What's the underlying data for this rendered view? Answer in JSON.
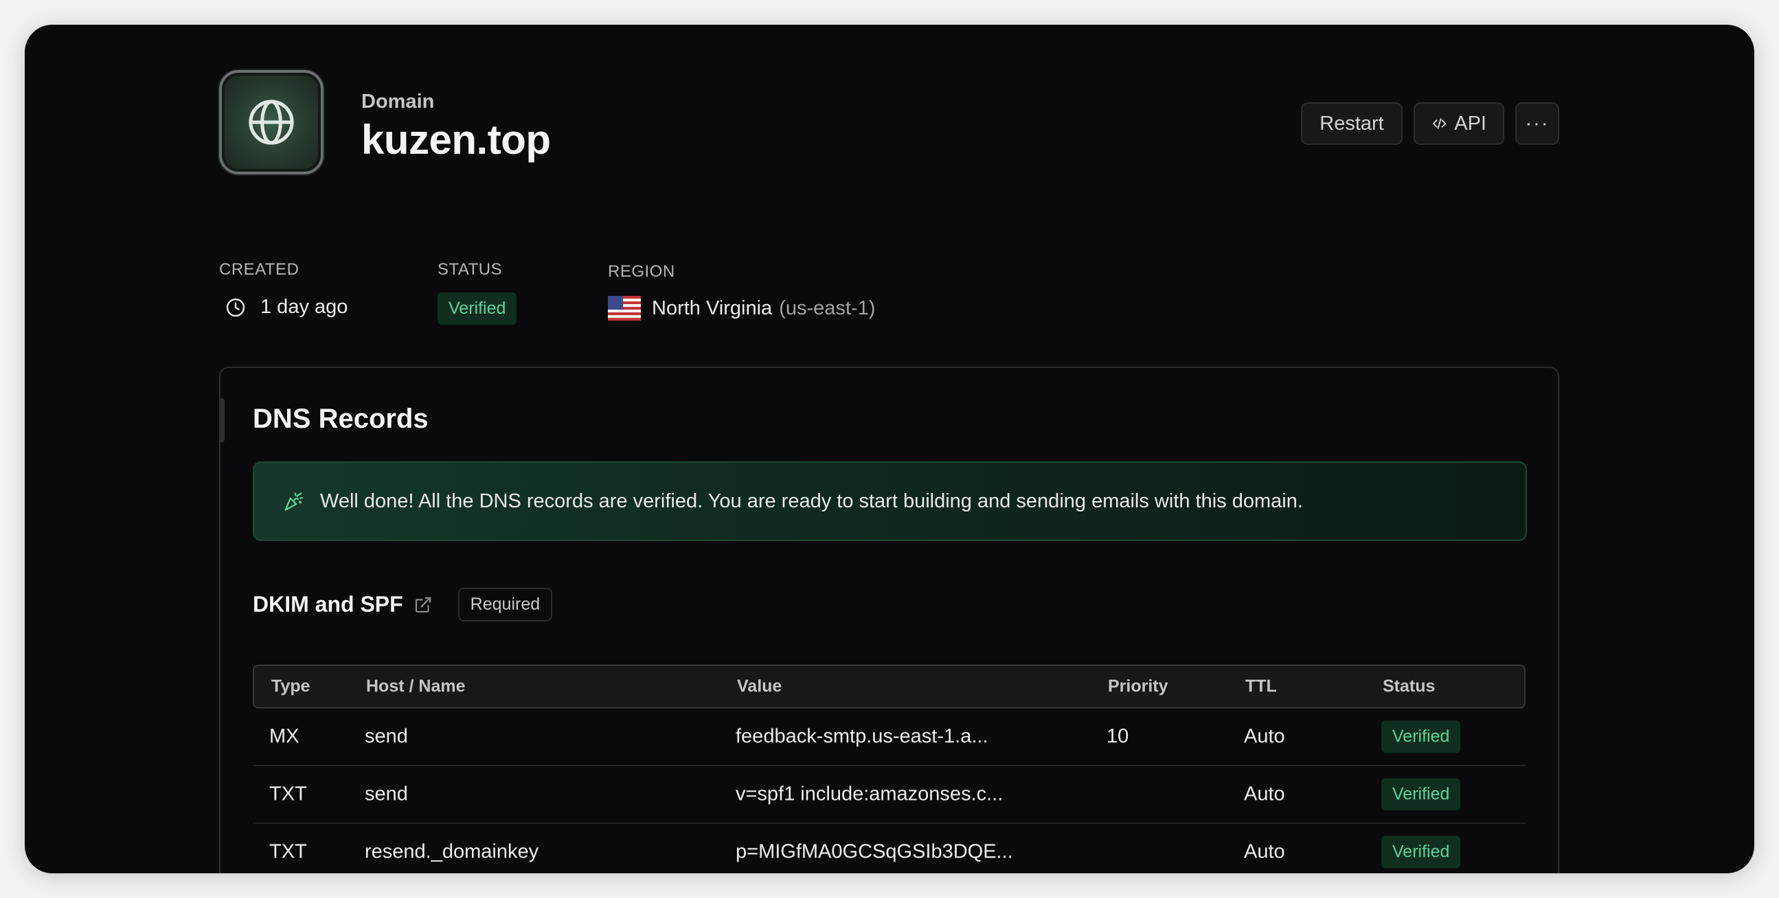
{
  "header": {
    "label": "Domain",
    "title": "kuzen.top",
    "icon": "globe-icon",
    "actions": {
      "restart": "Restart",
      "api": "API",
      "more": "···"
    }
  },
  "meta": {
    "created_label": "CREATED",
    "created_value": "1 day ago",
    "status_label": "STATUS",
    "status_value": "Verified",
    "region_label": "REGION",
    "region_name": "North Virginia",
    "region_code": "(us-east-1)"
  },
  "dns": {
    "title": "DNS Records",
    "alert": "Well done! All the DNS records are verified. You are ready to start building and sending emails with this domain.",
    "section_title": "DKIM and SPF",
    "required": "Required",
    "columns": [
      "Type",
      "Host / Name",
      "Value",
      "Priority",
      "TTL",
      "Status"
    ],
    "rows": [
      {
        "type": "MX",
        "host": "send",
        "value": "feedback-smtp.us-east-1.a...",
        "priority": "10",
        "ttl": "Auto",
        "status": "Verified"
      },
      {
        "type": "TXT",
        "host": "send",
        "value": "v=spf1 include:amazonses.c...",
        "priority": "",
        "ttl": "Auto",
        "status": "Verified"
      },
      {
        "type": "TXT",
        "host": "resend._domainkey",
        "value": "p=MIGfMA0GCSqGSIb3DQE...",
        "priority": "",
        "ttl": "Auto",
        "status": "Verified"
      }
    ]
  },
  "colors": {
    "background": "#0a0a0c",
    "badge_bg": "#0f2e1f",
    "badge_text": "#5fd39a",
    "alert_border": "#1e4a36"
  }
}
